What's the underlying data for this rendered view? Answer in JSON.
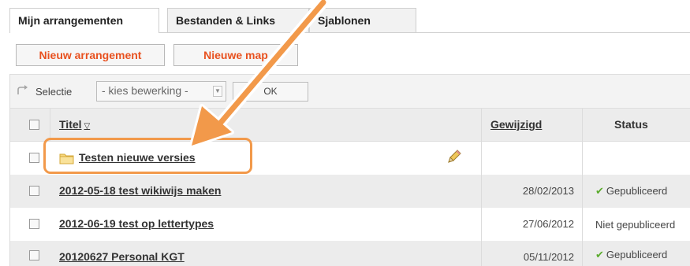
{
  "tabs": [
    {
      "label": "Mijn arrangementen",
      "active": true
    },
    {
      "label": "Bestanden & Links",
      "active": false
    },
    {
      "label": "Sjablonen",
      "active": false
    }
  ],
  "actions": {
    "new_arrangement": "Nieuw arrangement",
    "new_folder": "Nieuwe map"
  },
  "selection": {
    "label": "Selectie",
    "dropdown_value": "- kies bewerking -",
    "ok_label": "OK"
  },
  "table": {
    "columns": {
      "title": "Titel",
      "modified": "Gewijzigd",
      "status": "Status"
    },
    "rows": [
      {
        "title": "Testen nieuwe versies",
        "type": "folder",
        "date": "",
        "status": ""
      },
      {
        "title": "2012-05-18 test wikiwijs maken",
        "type": "item",
        "date": "28/02/2013",
        "status": "Gepubliceerd"
      },
      {
        "title": "2012-06-19 test op lettertypes",
        "type": "item",
        "date": "27/06/2012",
        "status": "Niet gepubliceerd"
      },
      {
        "title": "20120627 Personal KGT",
        "type": "item",
        "date": "05/11/2012",
        "status": "Gepubliceerd"
      }
    ]
  },
  "colors": {
    "accent_orange": "#e8511f",
    "highlight_orange": "#f2994a",
    "published_green": "#5aab2c"
  },
  "icons": [
    "redo-arrow-icon",
    "sort-down-icon",
    "folder-icon",
    "pencil-icon",
    "check-icon"
  ]
}
